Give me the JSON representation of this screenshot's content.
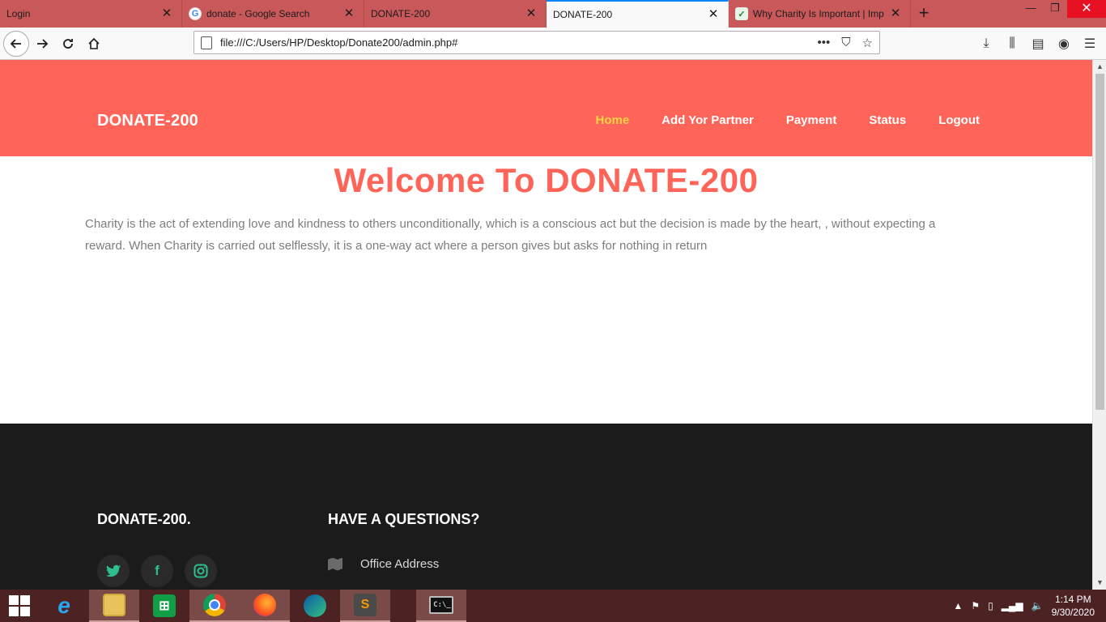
{
  "browser": {
    "tabs": [
      {
        "title": "Login",
        "favicon": "none",
        "active": false
      },
      {
        "title": "donate - Google Search",
        "favicon": "google-icon",
        "active": false
      },
      {
        "title": "DONATE-200",
        "favicon": "none",
        "active": false
      },
      {
        "title": "DONATE-200",
        "favicon": "none",
        "active": true
      },
      {
        "title": "Why Charity Is Important | Imp",
        "favicon": "leaf-icon",
        "active": false
      }
    ],
    "url": "file:///C:/Users/HP/Desktop/Donate200/admin.php#",
    "active_tab_color": "#0a84ff",
    "tabstrip_color": "#c9585a"
  },
  "site": {
    "brand": "DONATE-200",
    "menu": [
      {
        "label": "Home",
        "current": true
      },
      {
        "label": "Add Yor Partner",
        "current": false
      },
      {
        "label": "Payment",
        "current": false
      },
      {
        "label": "Status",
        "current": false
      },
      {
        "label": "Logout",
        "current": false
      }
    ],
    "accent": "#ff6459",
    "menu_highlight": "#fdd545"
  },
  "main": {
    "heading": "Welcome To DONATE-200",
    "intro": "Charity is the act of extending love and kindness to others unconditionally, which is a conscious act but the decision is made by the heart, , without expecting a reward. When Charity is carried out selflessly, it is a one-way act where a person gives but asks for nothing in return"
  },
  "footer": {
    "brand": "DONATE-200.",
    "questions_heading": "HAVE A QUESTIONS?",
    "social": [
      "twitter-icon",
      "facebook-icon",
      "instagram-icon"
    ],
    "office_label": "Office Address",
    "background": "#1c1b1c"
  },
  "taskbar": {
    "apps": [
      "internet-explorer-icon",
      "file-explorer-icon",
      "store-icon",
      "chrome-icon",
      "firefox-icon",
      "edge-icon",
      "sublime-text-icon",
      "command-prompt-icon"
    ],
    "time": "1:14 PM",
    "date": "9/30/2020"
  }
}
